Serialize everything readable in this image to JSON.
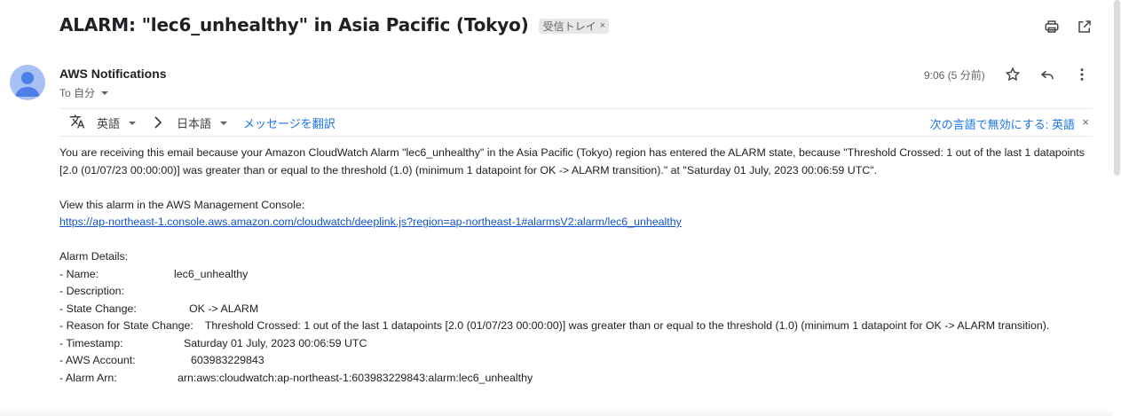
{
  "subject": "ALARM: \"lec6_unhealthy\" in Asia Pacific (Tokyo)",
  "label_chip": {
    "text": "受信トレイ",
    "close": "×"
  },
  "top_actions": {
    "print_icon": "print-icon",
    "open_new_window_icon": "open-in-new-icon"
  },
  "sender": {
    "name": "AWS Notifications",
    "to": "To 自分"
  },
  "time": "9:06 (5 分前)",
  "msg_actions": {
    "star_icon": "star-icon",
    "reply_icon": "reply-icon",
    "more_icon": "more-vert-icon"
  },
  "translate": {
    "source_lang": "英語",
    "target_lang": "日本語",
    "translate_link": "メッセージを翻訳",
    "disable_link": "次の言語で無効にする: 英語",
    "close": "×"
  },
  "email_body": {
    "intro": "You are receiving this email because your Amazon CloudWatch Alarm \"lec6_unhealthy\" in the Asia Pacific (Tokyo) region has entered the ALARM state, because \"Threshold Crossed: 1 out of the last 1 datapoints [2.0 (01/07/23 00:00:00)] was greater than or equal to the threshold (1.0) (minimum 1 datapoint for OK -> ALARM transition).\" at \"Saturday 01 July, 2023 00:06:59 UTC\".",
    "view_label": "View this alarm in the AWS Management Console:",
    "console_link": "https://ap-northeast-1.console.aws.amazon.com/cloudwatch/deeplink.js?region=ap-northeast-1#alarmsV2:alarm/lec6_unhealthy",
    "details_heading": "Alarm Details:",
    "details": [
      {
        "key": "- Name:",
        "value": "lec6_unhealthy"
      },
      {
        "key": "- Description:",
        "value": ""
      },
      {
        "key": "- State Change:",
        "value": "OK -> ALARM"
      },
      {
        "key": "- Reason for State Change:",
        "value": "Threshold Crossed: 1 out of the last 1 datapoints [2.0 (01/07/23 00:00:00)] was greater than or equal to the threshold (1.0) (minimum 1 datapoint for OK -> ALARM transition)."
      },
      {
        "key": "- Timestamp:",
        "value": "Saturday 01 July, 2023 00:06:59 UTC"
      },
      {
        "key": "- AWS Account:",
        "value": "603983229843"
      },
      {
        "key": "- Alarm Arn:",
        "value": "arn:aws:cloudwatch:ap-northeast-1:603983229843:alarm:lec6_unhealthy"
      }
    ]
  }
}
